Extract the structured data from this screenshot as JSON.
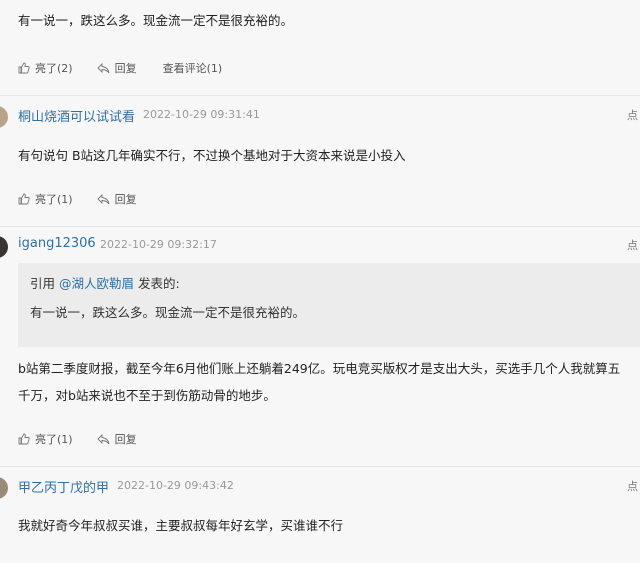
{
  "comments": [
    {
      "content": "有一说一，跌这么多。现金流一定不是很充裕的。",
      "like": "亮了(2)",
      "reply": "回复",
      "view_replies": "查看评论(1)"
    },
    {
      "user": "桐山烧酒可以试试看",
      "time": "2022-10-29 09:31:41",
      "more": "点",
      "content": "有句说句 B站这几年确实不行，不过换个基地对于大资本来说是小投入",
      "like": "亮了(1)",
      "reply": "回复"
    },
    {
      "user": "igang12306",
      "time": "2022-10-29 09:32:17",
      "more": "点",
      "quote_prefix": "引用 ",
      "quote_user": "@湖人欧勒眉",
      "quote_suffix": " 发表的:",
      "quote_text": "有一说一，跌这么多。现金流一定不是很充裕的。",
      "content_line1": "b站第二季度财报，截至今年6月他们账上还躺着249亿。玩电竞买版权才是支出大头，买选手几个人我就算五",
      "content_line2": "千万，对b站来说也不至于到伤筋动骨的地步。",
      "like": "亮了(1)",
      "reply": "回复"
    },
    {
      "user": "甲乙丙丁戊的甲",
      "time": "2022-10-29 09:43:42",
      "more": "点",
      "content": "我就好奇今年叔叔买谁，主要叔叔每年好玄学，买谁谁不行"
    }
  ],
  "colors": {
    "username": "#2f6fa6",
    "background": "#f7f7f7",
    "quote_bg": "#ececec",
    "divider": "#e6e6e6"
  },
  "icons": [
    "like-icon",
    "reply-icon",
    "avatar"
  ]
}
